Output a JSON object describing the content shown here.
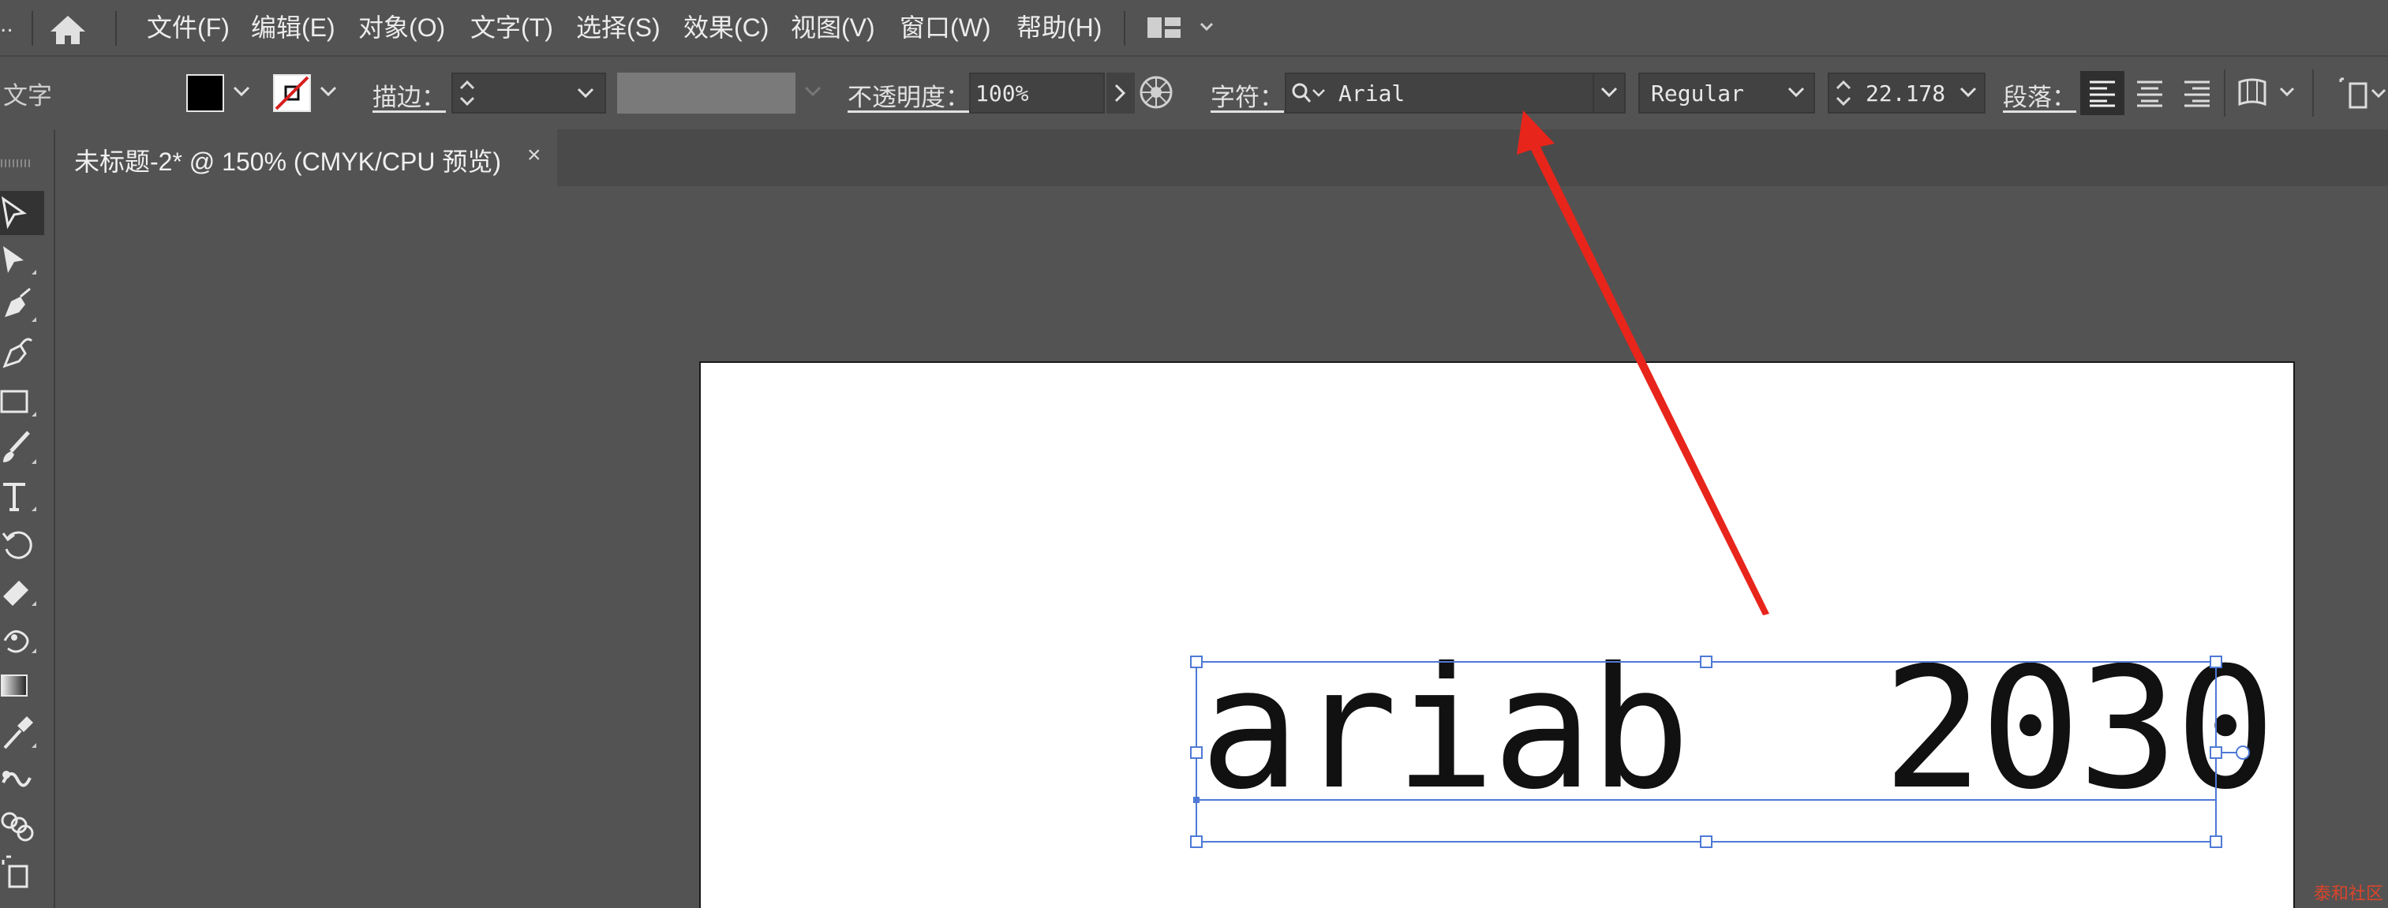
{
  "menubar": {
    "overflow": "..",
    "items": [
      "文件(F)",
      "编辑(E)",
      "对象(O)",
      "文字(T)",
      "选择(S)",
      "效果(C)",
      "视图(V)",
      "窗口(W)",
      "帮助(H)"
    ]
  },
  "control_bar": {
    "context_label": "文字",
    "stroke_label": "描边：",
    "opacity_label": "不透明度：",
    "opacity_value": "100%",
    "character_label": "字符：",
    "font_family": "Arial",
    "font_style": "Regular",
    "font_size": "22.178",
    "paragraph_label": "段落："
  },
  "document": {
    "tab_title": "未标题-2* @ 150% (CMYK/CPU 预览)",
    "close_glyph": "×"
  },
  "artboard": {
    "text": "ariab  2030"
  },
  "watermark": "泰和社区",
  "colors": {
    "annotation_arrow": "#e8251b",
    "selection": "#4f79d6",
    "fill_swatch": "#000000"
  }
}
